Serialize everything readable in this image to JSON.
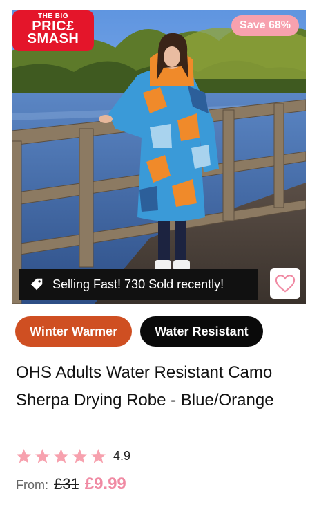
{
  "product": {
    "promo_badge": {
      "line1": "THE BIG",
      "line2": "PRIC£",
      "line3": "SMASH"
    },
    "save_badge": "Save 68%",
    "selling_banner": "Selling Fast! 730 Sold recently!",
    "tags": [
      "Winter Warmer",
      "Water Resistant"
    ],
    "title": "OHS Adults Water Resistant Camo Sherpa Drying Robe - Blue/Orange",
    "rating": {
      "stars": 5,
      "value": "4.9"
    },
    "price": {
      "from_label": "From:",
      "was": "£31",
      "now": "£9.99"
    }
  },
  "colors": {
    "save_badge": "#f7a1ae",
    "tag_orange": "#cf4f22",
    "tag_black": "#0a0a0a",
    "star": "#f7a1ae",
    "price_now": "#f08aa3",
    "promo_red": "#e4152a"
  },
  "icons": {
    "banner": "tag-icon",
    "wishlist": "heart-outline-icon",
    "rating": "star-icon"
  }
}
